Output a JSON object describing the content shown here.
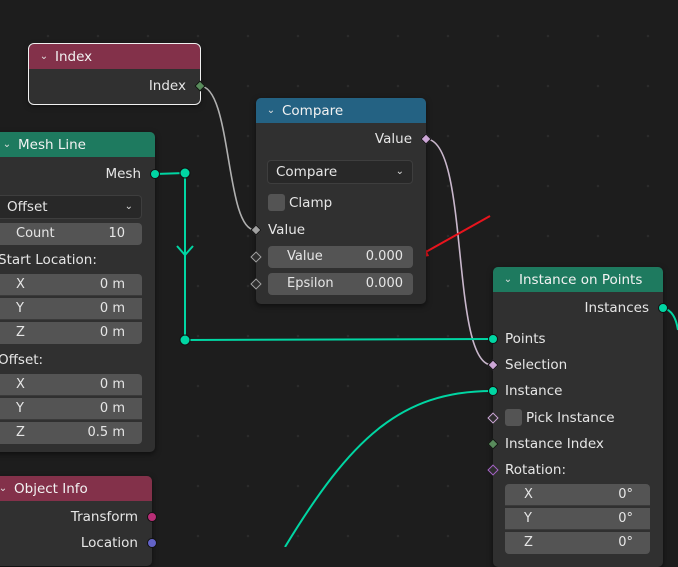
{
  "colors": {
    "geometry_socket": "#00d6a3",
    "input_header": "#83314a",
    "utility_header": "#246283",
    "geometry_header": "#1e7a5f",
    "float_socket": "#a1a1a1",
    "bool_socket": "#cca6d6",
    "int_socket": "#598c5c",
    "vector_socket": "#6363c7",
    "rotation_socket": "#a663c7",
    "matrix_socket": "#b82e76",
    "annotation_arrow": "#e8141d"
  },
  "index_node": {
    "title": "Index",
    "output_label": "Index"
  },
  "compare_node": {
    "title": "Compare",
    "output_label": "Value",
    "mode": "Compare",
    "clamp_label": "Clamp",
    "input_label": "Value",
    "value_label": "Value",
    "value": "0.000",
    "epsilon_label": "Epsilon",
    "epsilon": "0.000"
  },
  "mesh_line_node": {
    "title": "Mesh Line",
    "output_label": "Mesh",
    "mode": "Offset",
    "count_label": "Count",
    "count": "10",
    "start_location_label": "Start Location:",
    "start_location": [
      {
        "axis": "X",
        "value": "0 m"
      },
      {
        "axis": "Y",
        "value": "0 m"
      },
      {
        "axis": "Z",
        "value": "0 m"
      }
    ],
    "offset_label": "Offset:",
    "offset": [
      {
        "axis": "X",
        "value": "0 m"
      },
      {
        "axis": "Y",
        "value": "0 m"
      },
      {
        "axis": "Z",
        "value": "0.5 m"
      }
    ]
  },
  "object_info_node": {
    "title": "Object Info",
    "transform_label": "Transform",
    "location_label": "Location"
  },
  "instance_on_points_node": {
    "title": "Instance on Points",
    "output_label": "Instances",
    "points_label": "Points",
    "selection_label": "Selection",
    "instance_label": "Instance",
    "pick_instance_label": "Pick Instance",
    "instance_index_label": "Instance Index",
    "rotation_label": "Rotation:",
    "rotation": [
      {
        "axis": "X",
        "value": "0°"
      },
      {
        "axis": "Y",
        "value": "0°"
      },
      {
        "axis": "Z",
        "value": "0°"
      }
    ]
  }
}
